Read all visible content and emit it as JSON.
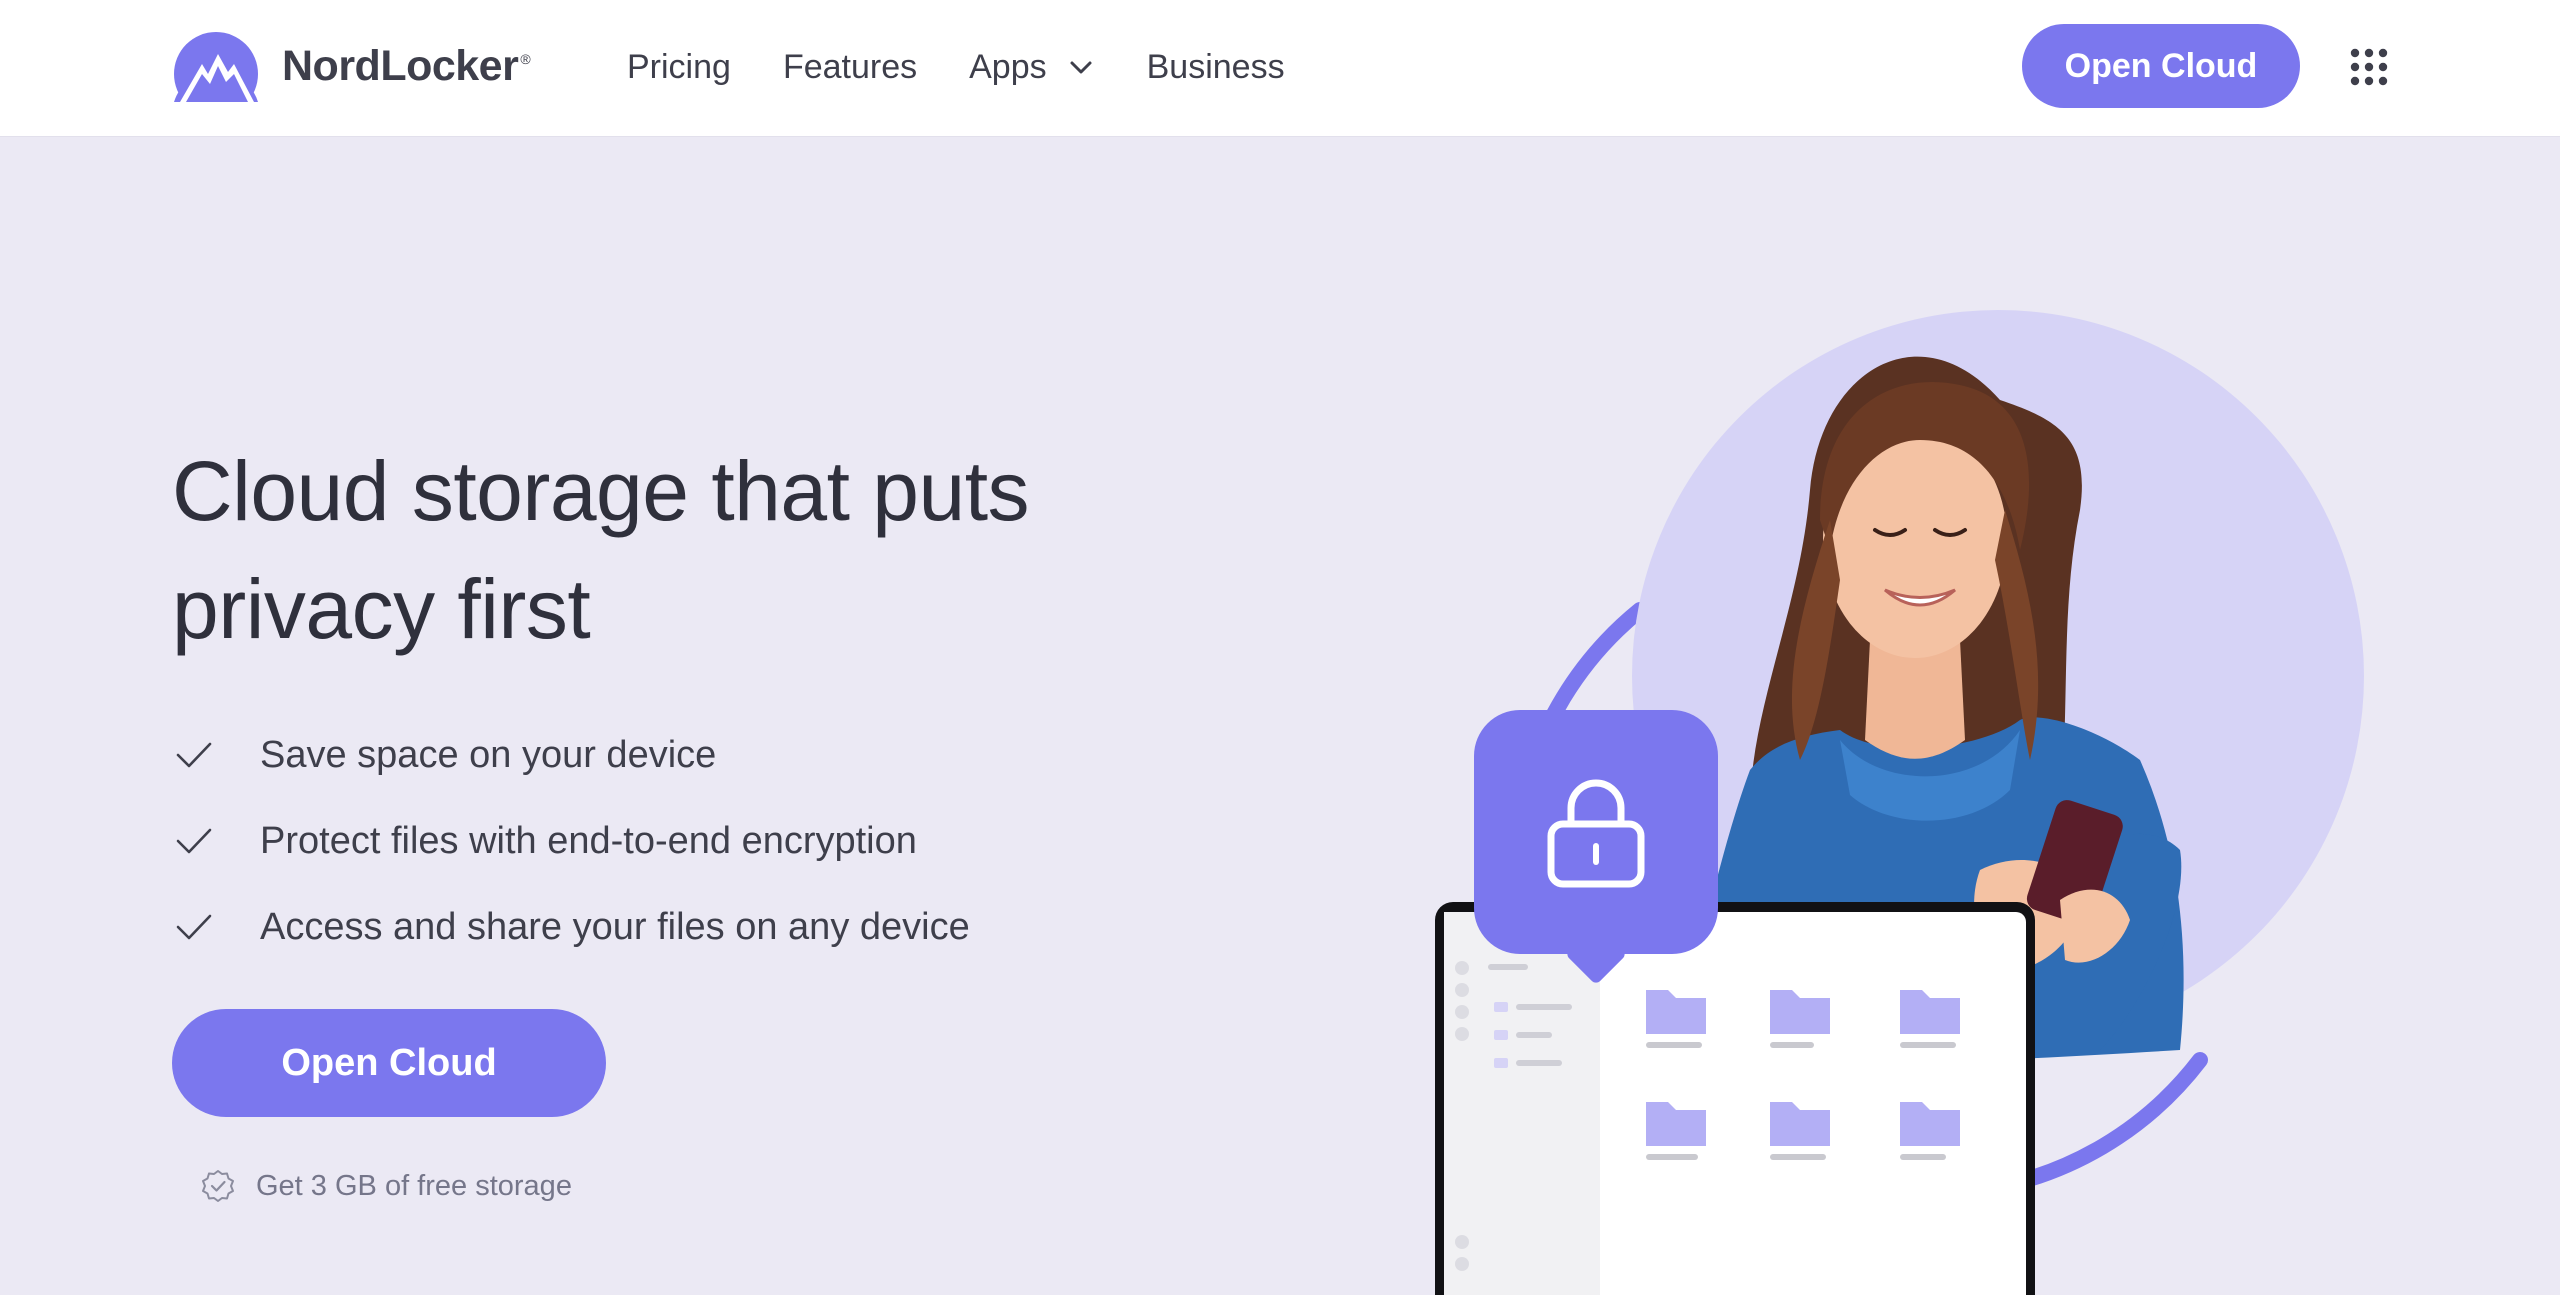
{
  "brand": {
    "name": "NordLocker",
    "registered_mark": "®",
    "accent_color": "#7b77ee",
    "text_color": "#3e3f4b",
    "background_color": "#ebe9f4"
  },
  "nav": {
    "items": [
      {
        "label": "Pricing"
      },
      {
        "label": "Features"
      },
      {
        "label": "Apps",
        "icon": "chevron-down-icon"
      },
      {
        "label": "Business"
      }
    ],
    "cta_label": "Open Cloud",
    "menu_icon": "grid-apps-icon"
  },
  "hero": {
    "title_line1": "Cloud storage that puts",
    "title_line2": "privacy first",
    "features": [
      "Save space on your device",
      "Protect files with end-to-end encryption",
      "Access and share your files on any device"
    ],
    "cta_label": "Open Cloud",
    "free_storage_text": "Get 3 GB of free storage",
    "illustration": {
      "subject": "woman-using-phone",
      "lock_icon": "lock-icon",
      "device": "laptop-file-browser"
    }
  }
}
